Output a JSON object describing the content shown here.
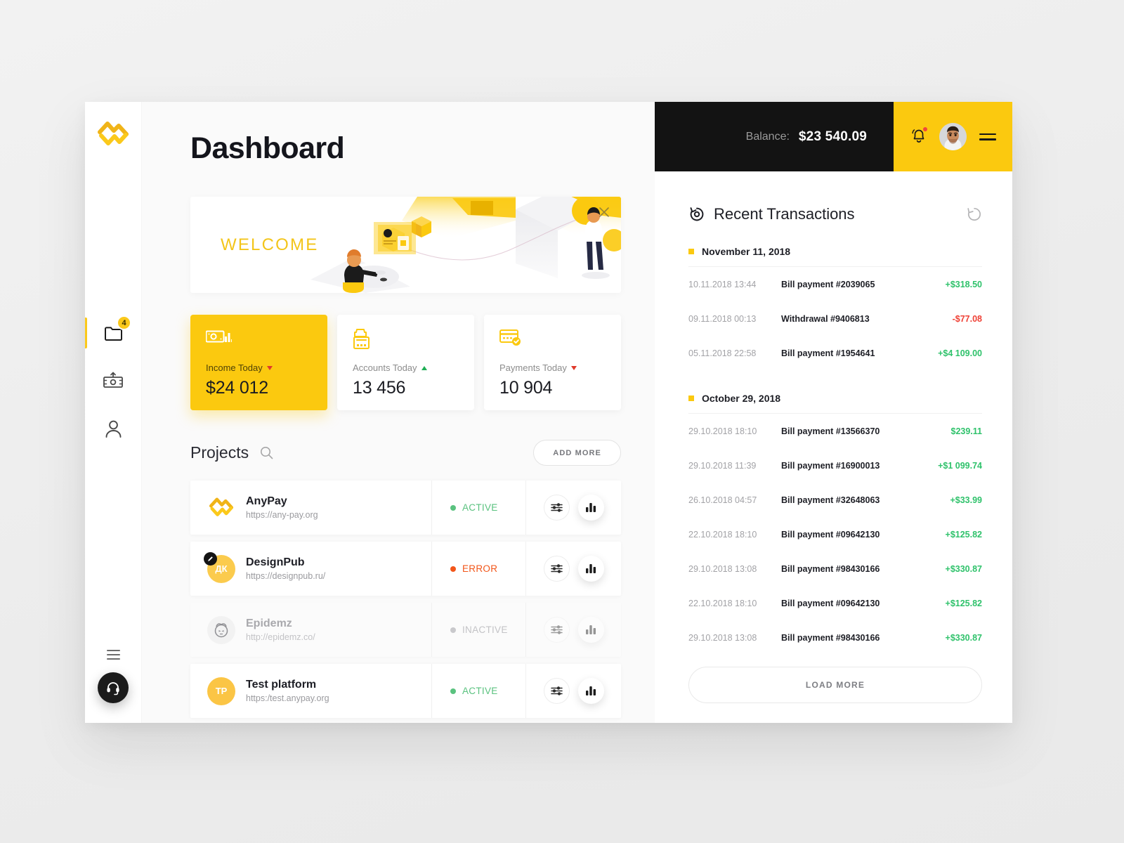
{
  "sidebar": {
    "logo": "anypay-logo-icon",
    "items": [
      {
        "name": "projects",
        "icon": "folder-icon",
        "badge": "4",
        "active": true
      },
      {
        "name": "payments",
        "icon": "money-out-icon",
        "badge": "",
        "active": false
      },
      {
        "name": "profile",
        "icon": "user-icon",
        "badge": "",
        "active": false
      }
    ],
    "menu_icon": "hamburger-icon",
    "support_icon": "headset-icon"
  },
  "header": {
    "title": "Dashboard"
  },
  "welcome": {
    "text": "WELCOME",
    "close_icon": "close-icon"
  },
  "stats": [
    {
      "icon": "cash-chart-icon",
      "label": "Income Today",
      "trend": "down",
      "value": "$24 012",
      "accent": true
    },
    {
      "icon": "cash-register-icon",
      "label": "Accounts Today",
      "trend": "up",
      "value": "13 456",
      "accent": false
    },
    {
      "icon": "card-check-icon",
      "label": "Payments Today",
      "trend": "down",
      "value": "10 904",
      "accent": false
    }
  ],
  "projects": {
    "title": "Projects",
    "search_icon": "search-icon",
    "add_more_label": "ADD MORE",
    "rows": [
      {
        "name": "AnyPay",
        "url": "https://any-pay.org",
        "status": "ACTIVE",
        "status_color": "#5ac27f",
        "avatar_type": "logo",
        "avatar_initials": "",
        "avatar_bg": "#ffffff",
        "dim": false,
        "badge": false
      },
      {
        "name": "DesignPub",
        "url": "https://designpub.ru/",
        "status": "ERROR",
        "status_color": "#f2561a",
        "avatar_type": "initials",
        "avatar_initials": "ДК",
        "avatar_bg": "#FBCB4D",
        "dim": false,
        "badge": true
      },
      {
        "name": "Epidemz",
        "url": "http://epidemz.co/",
        "status": "INACTIVE",
        "status_color": "#c9c9cc",
        "avatar_type": "face",
        "avatar_initials": "",
        "avatar_bg": "#f2f2f2",
        "dim": true,
        "badge": false
      },
      {
        "name": "Test platform",
        "url": "https:/test.anypay.org",
        "status": "ACTIVE",
        "status_color": "#5ac27f",
        "avatar_type": "initials",
        "avatar_initials": "TP",
        "avatar_bg": "#FBC545",
        "dim": false,
        "badge": false
      }
    ],
    "action_settings_icon": "sliders-icon",
    "action_stats_icon": "bar-chart-icon"
  },
  "topbar": {
    "balance_label": "Balance:",
    "balance_value": "$23 540.09",
    "bell_icon": "bell-icon",
    "has_notification": true,
    "avatar_icon": "user-avatar",
    "menu_icon": "hamburger-icon"
  },
  "transactions": {
    "title": "Recent Transactions",
    "title_icon": "refresh-circle-icon",
    "refresh_icon": "refresh-icon",
    "load_more_label": "LOAD MORE",
    "groups": [
      {
        "date": "November 11, 2018",
        "rows": [
          {
            "time": "10.11.2018 13:44",
            "desc": "Bill payment #2039065",
            "amount": "+$318.50",
            "sign": "pos"
          },
          {
            "time": "09.11.2018 00:13",
            "desc": "Withdrawal #9406813",
            "amount": "-$77.08",
            "sign": "neg"
          },
          {
            "time": "05.11.2018 22:58",
            "desc": "Bill payment #1954641",
            "amount": "+$4 109.00",
            "sign": "pos"
          }
        ]
      },
      {
        "date": "October 29, 2018",
        "rows": [
          {
            "time": "29.10.2018 18:10",
            "desc": "Bill payment #13566370",
            "amount": "$239.11",
            "sign": "pos"
          },
          {
            "time": "29.10.2018 11:39",
            "desc": "Bill payment #16900013",
            "amount": "+$1 099.74",
            "sign": "pos"
          },
          {
            "time": "26.10.2018 04:57",
            "desc": "Bill payment #32648063",
            "amount": "+$33.99",
            "sign": "pos"
          },
          {
            "time": "22.10.2018 18:10",
            "desc": "Bill payment #09642130",
            "amount": "+$125.82",
            "sign": "pos"
          },
          {
            "time": "29.10.2018 13:08",
            "desc": "Bill payment #98430166",
            "amount": "+$330.87",
            "sign": "pos"
          },
          {
            "time": "22.10.2018 18:10",
            "desc": "Bill payment #09642130",
            "amount": "+$125.82",
            "sign": "pos"
          },
          {
            "time": "29.10.2018 13:08",
            "desc": "Bill payment #98430166",
            "amount": "+$330.87",
            "sign": "pos"
          }
        ]
      }
    ]
  },
  "colors": {
    "accent_yellow": "#FBC90F",
    "dark": "#131313",
    "positive": "#2fc26b",
    "negative": "#ef4136",
    "active": "#5ac27f",
    "error": "#f2561a",
    "inactive": "#c9c9cc"
  }
}
